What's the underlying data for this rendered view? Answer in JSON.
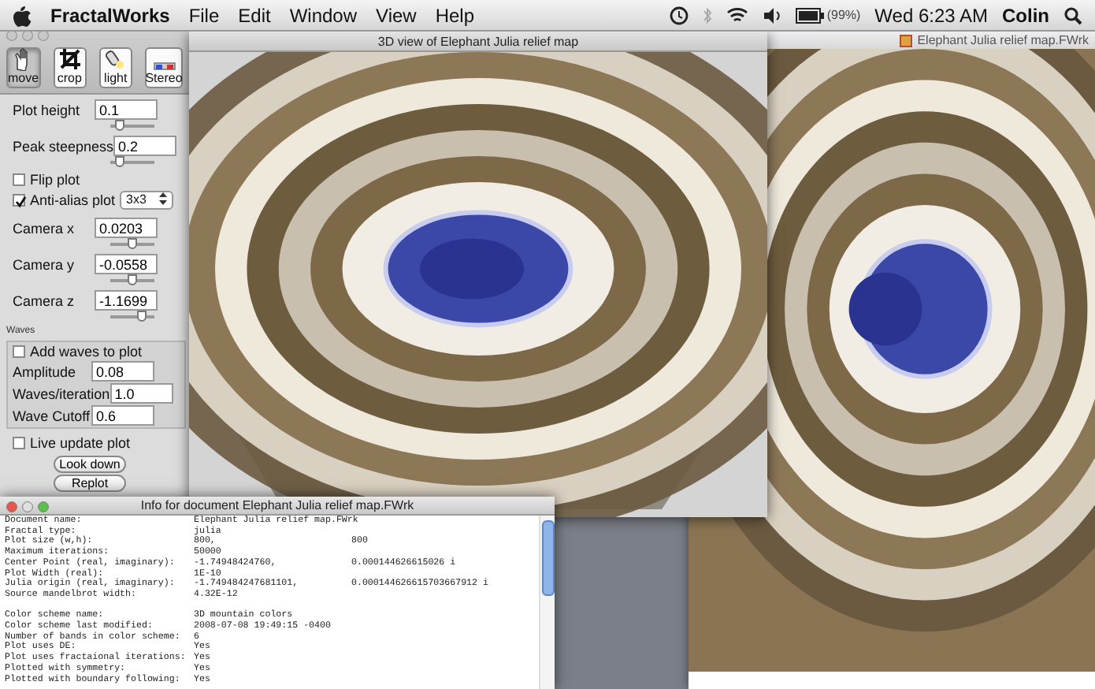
{
  "menu_bar": {
    "app": "FractalWorks",
    "menus": [
      "File",
      "Edit",
      "Window",
      "View",
      "Help"
    ],
    "battery": "(99%)",
    "clock": "Wed 6:23 AM",
    "user": "Colin"
  },
  "tool_panel": {
    "tools": [
      {
        "kind": "hand",
        "label": "move",
        "selected": true
      },
      {
        "kind": "crop",
        "label": "crop",
        "selected": false
      },
      {
        "kind": "light",
        "label": "light",
        "selected": false
      },
      {
        "kind": "stereo",
        "label": "Stereo",
        "selected": false
      }
    ],
    "controls": [
      {
        "kind": "field",
        "label": "Plot height",
        "value": "0.1",
        "level": 0.2
      },
      {
        "kind": "field",
        "label": "Peak steepness",
        "value": "0.2",
        "level": 0.2
      },
      {
        "kind": "checkbox",
        "label": "Flip plot",
        "checked": false
      },
      {
        "kind": "select",
        "label": "Anti-alias plot",
        "checked": true,
        "value": "3x3"
      },
      {
        "kind": "field",
        "label": "Camera x",
        "value": "0.0203",
        "level": 0.5
      },
      {
        "kind": "field",
        "label": "Camera y",
        "value": "-0.0558",
        "level": 0.5
      },
      {
        "kind": "field",
        "label": "Camera z",
        "value": "-1.1699",
        "level": 0.7
      }
    ],
    "waves": {
      "title": "Waves",
      "add_label": "Add waves to plot",
      "add_checked": false,
      "fields": [
        {
          "label": "Amplitude",
          "value": "0.08"
        },
        {
          "label": "Waves/iteration",
          "value": "1.0"
        },
        {
          "label": "Wave Cutoff",
          "value": "0.6"
        }
      ]
    },
    "live_update": {
      "label": "Live update plot",
      "checked": false
    },
    "buttons": [
      "Look down",
      "Replot"
    ]
  },
  "view_window": {
    "title": "3D view of Elephant Julia relief map"
  },
  "document_window": {
    "title": "Elephant Julia relief map.FWrk"
  },
  "info_window": {
    "title": "Info for document Elephant Julia relief map.FWrk",
    "sections": [
      [
        {
          "label": "Document name:",
          "value": "Elephant Julia relief map.FWrk"
        },
        {
          "label": "Fractal type:",
          "value": "julia"
        },
        {
          "label": "Plot size (w,h):",
          "value": "800,",
          "value2": "800"
        },
        {
          "label": "Maximum iterations:",
          "value": "50000"
        },
        {
          "label": "Center Point (real, imaginary):",
          "value": "-1.74948424760,",
          "value2": "0.000144626615026 i"
        },
        {
          "label": "Plot Width (real):",
          "value": "1E-10"
        },
        {
          "label": "Julia origin (real, imaginary):",
          "value": "-1.749484247681101,",
          "value2": "0.000144626615703667912 i"
        },
        {
          "label": "Source mandelbrot width:",
          "value": "4.32E-12"
        }
      ],
      [
        {
          "label": "Color scheme name:",
          "value": "3D mountain colors"
        },
        {
          "label": "Color scheme last modified:",
          "value": "2008-07-08 19:49:15 -0400"
        },
        {
          "label": "Number of bands in color scheme:",
          "value": "6"
        },
        {
          "label": "Plot uses DE:",
          "value": "Yes"
        },
        {
          "label": "Plot uses fractaional iterations:",
          "value": "Yes"
        },
        {
          "label": "Plotted with symmetry:",
          "value": "Yes"
        },
        {
          "label": "Plotted with boundary following:",
          "value": "Yes"
        }
      ]
    ]
  }
}
